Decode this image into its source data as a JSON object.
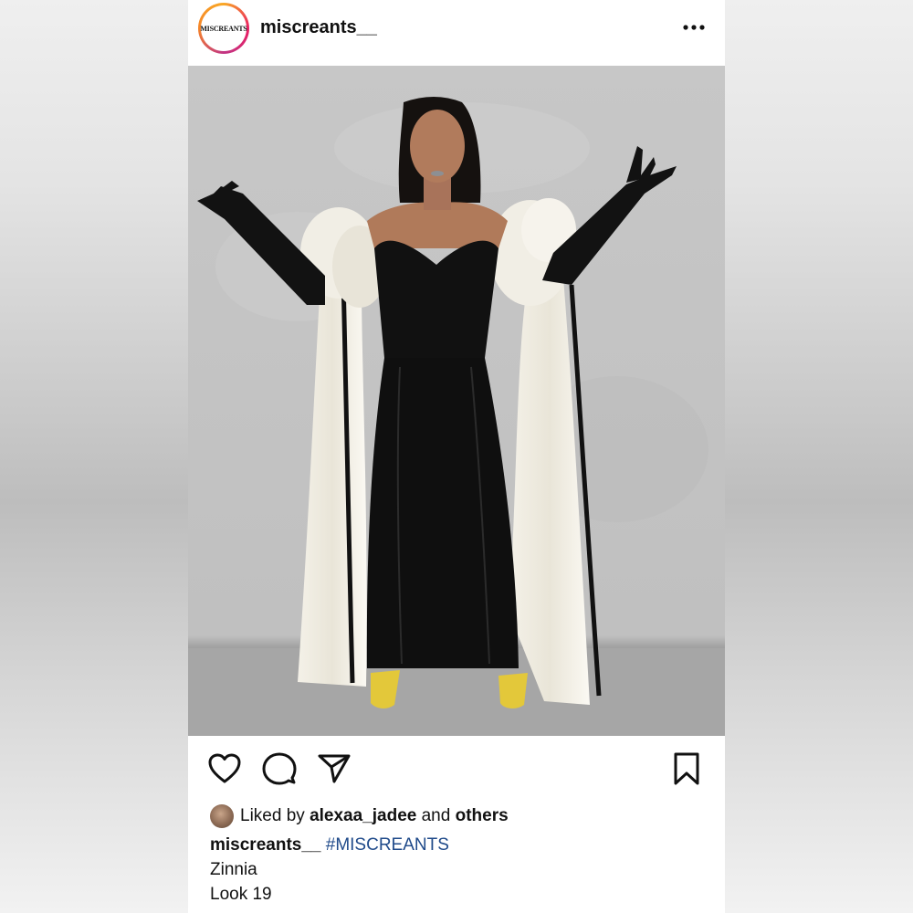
{
  "post": {
    "username": "miscreants__",
    "avatar_text": "MISCREANTS",
    "more_icon": "more-horizontal-icon",
    "image_alt": "Model in black strapless velvet gown with white bows and black opera gloves"
  },
  "actions": {
    "like_icon": "heart-icon",
    "comment_icon": "comment-icon",
    "share_icon": "send-icon",
    "save_icon": "bookmark-icon"
  },
  "likes": {
    "prefix": "Liked by",
    "user": "alexaa_jadee",
    "connector": "and",
    "suffix": "others"
  },
  "caption": {
    "username": "miscreants__",
    "hashtag": "#MISCREANTS",
    "line1": "Zinnia",
    "line2": "Look 19"
  },
  "colors": {
    "hashtag": "#1f4a8a",
    "text": "#111111"
  }
}
